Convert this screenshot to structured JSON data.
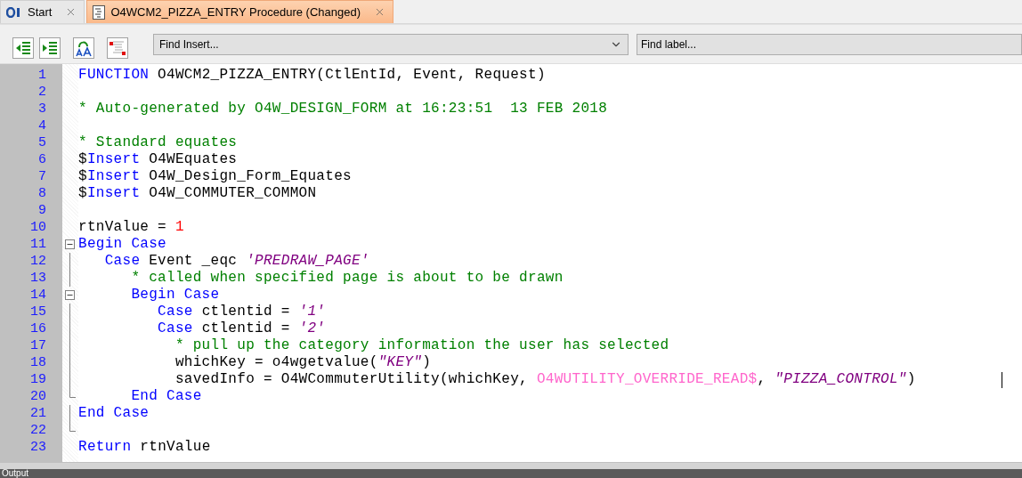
{
  "tabs": [
    {
      "label": "Start",
      "kind": "start",
      "selected": false
    },
    {
      "label": "O4WCM2_PIZZA_ENTRY Procedure (Changed)",
      "kind": "procedure",
      "selected": true
    }
  ],
  "toolbar": {
    "find_insert": {
      "placeholder": "Find Insert..."
    },
    "find_label": {
      "placeholder": "Find label..."
    }
  },
  "editor": {
    "lines": [
      {
        "number": "1",
        "tokens": [
          {
            "kind": "keyword",
            "text": "FUNCTION"
          },
          {
            "kind": "plain",
            "text": " O4WCM2_PIZZA_ENTRY(CtlEntId, Event, Request)"
          }
        ]
      },
      {
        "number": "2"
      },
      {
        "number": "3",
        "tokens": [
          {
            "kind": "comment",
            "text": "* Auto-generated by O4W_DESIGN_FORM at 16:23:51  13 FEB 2018"
          }
        ]
      },
      {
        "number": "4"
      },
      {
        "number": "5",
        "tokens": [
          {
            "kind": "comment",
            "text": "* Standard equates"
          }
        ]
      },
      {
        "number": "6",
        "tokens": [
          {
            "kind": "plain",
            "text": "$"
          },
          {
            "kind": "keyword",
            "text": "Insert"
          },
          {
            "kind": "plain",
            "text": " O4WEquates"
          }
        ]
      },
      {
        "number": "7",
        "tokens": [
          {
            "kind": "plain",
            "text": "$"
          },
          {
            "kind": "keyword",
            "text": "Insert"
          },
          {
            "kind": "plain",
            "text": " O4W_Design_Form_Equates"
          }
        ]
      },
      {
        "number": "8",
        "tokens": [
          {
            "kind": "plain",
            "text": "$"
          },
          {
            "kind": "keyword",
            "text": "Insert"
          },
          {
            "kind": "plain",
            "text": " O4W_COMMUTER_COMMON"
          }
        ]
      },
      {
        "number": "9"
      },
      {
        "number": "10",
        "tokens": [
          {
            "kind": "plain",
            "text": "rtnValue = "
          },
          {
            "kind": "number",
            "text": "1"
          }
        ]
      },
      {
        "number": "11",
        "fold_start": true,
        "expanded": true,
        "tokens": [
          {
            "kind": "keyword",
            "text": "Begin Case"
          }
        ]
      },
      {
        "number": "12",
        "tokens": [
          {
            "kind": "keyword",
            "text": "   Case"
          },
          {
            "kind": "plain",
            "text": " Event _eqc "
          },
          {
            "kind": "string",
            "text": "'PREDRAW_PAGE'"
          }
        ]
      },
      {
        "number": "13",
        "tokens": [
          {
            "kind": "comment",
            "text": "      * called when specified page is about to be drawn"
          }
        ]
      },
      {
        "number": "14",
        "fold_start": true,
        "expanded": true,
        "tokens": [
          {
            "kind": "keyword",
            "text": "      Begin Case"
          }
        ]
      },
      {
        "number": "15",
        "tokens": [
          {
            "kind": "keyword",
            "text": "         Case"
          },
          {
            "kind": "plain",
            "text": " ctlentid = "
          },
          {
            "kind": "string",
            "text": "'1'"
          }
        ]
      },
      {
        "number": "16",
        "tokens": [
          {
            "kind": "keyword",
            "text": "         Case"
          },
          {
            "kind": "plain",
            "text": " ctlentid = "
          },
          {
            "kind": "string",
            "text": "'2'"
          }
        ]
      },
      {
        "number": "17",
        "tokens": [
          {
            "kind": "comment",
            "text": "           * pull up the category information the user has selected"
          }
        ]
      },
      {
        "number": "18",
        "tokens": [
          {
            "kind": "plain",
            "text": "           whichKey = o4wgetvalue("
          },
          {
            "kind": "string",
            "text": "\"KEY\""
          },
          {
            "kind": "plain",
            "text": ")"
          }
        ]
      },
      {
        "number": "19",
        "cursor": true,
        "tokens": [
          {
            "kind": "plain",
            "text": "           savedInfo = O4WCommuterUtility(whichKey, "
          },
          {
            "kind": "constant",
            "text": "O4WUTILITY_OVERRIDE_READ$"
          },
          {
            "kind": "plain",
            "text": ", "
          },
          {
            "kind": "string",
            "text": "\"PIZZA_CONTROL\""
          },
          {
            "kind": "plain",
            "text": ")"
          }
        ]
      },
      {
        "number": "20",
        "fold_end": true,
        "tokens": [
          {
            "kind": "keyword",
            "text": "      End Case"
          }
        ]
      },
      {
        "number": "21",
        "tokens": [
          {
            "kind": "keyword",
            "text": "End Case"
          }
        ]
      },
      {
        "number": "22",
        "fold_end": true
      },
      {
        "number": "23",
        "tokens": [
          {
            "kind": "keyword",
            "text": "Return"
          },
          {
            "kind": "plain",
            "text": " rtnValue"
          }
        ]
      }
    ]
  },
  "output_panel": {
    "title": "Output"
  }
}
